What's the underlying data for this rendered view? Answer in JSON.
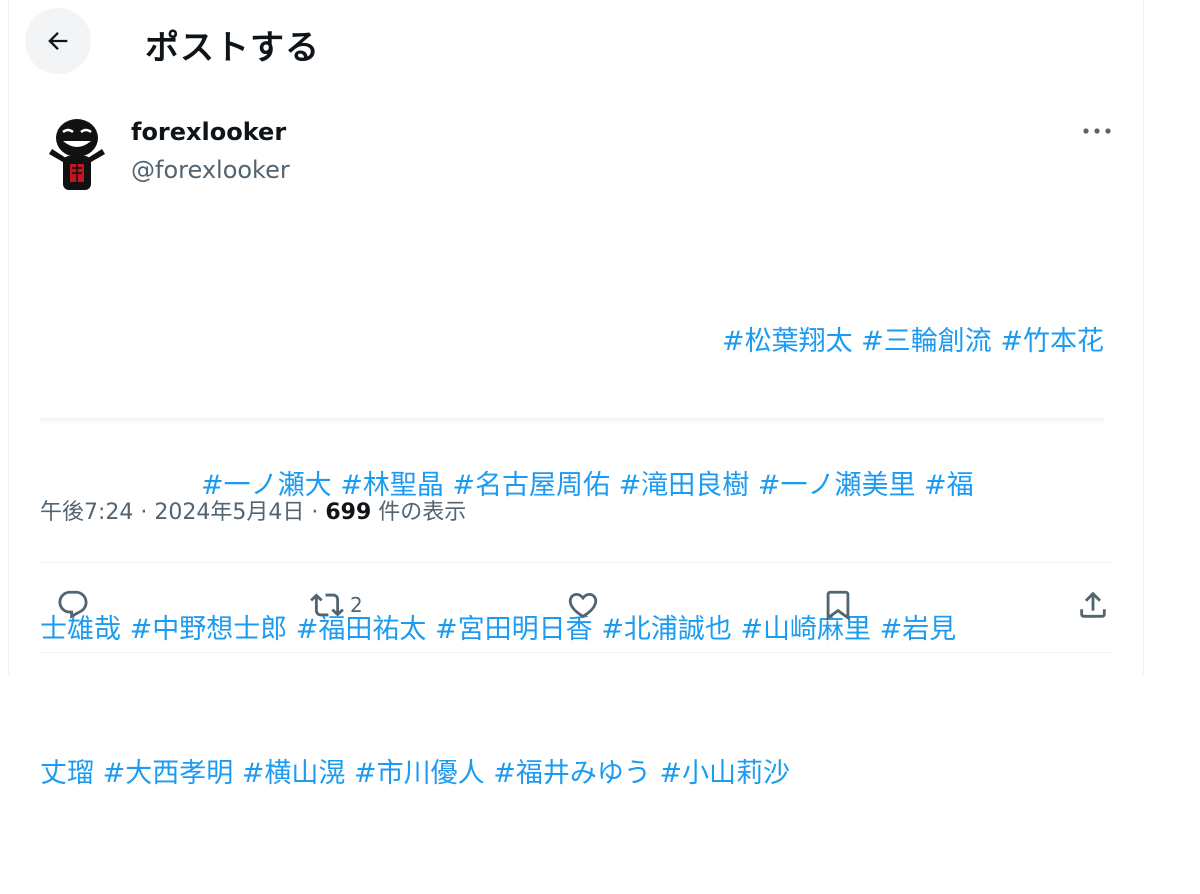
{
  "header": {
    "back_icon": "arrow-left-icon",
    "title": "ポストする"
  },
  "author": {
    "display_name": "forexlooker",
    "handle": "@forexlooker",
    "avatar_icon": "smiling-black-figure-avatar",
    "more_icon": "more-horizontal-icon"
  },
  "tweet": {
    "lines": [
      "#松葉翔太 #三輪創流 #竹本花",
      "#一ノ瀬大 #林聖晶 #名古屋周佑 #滝田良樹 #一ノ瀬美里 #福",
      "士雄哉 #中野想士郎 #福田祐太 #宮田明日香 #北浦誠也 #山崎麻里 #岩見",
      "丈瑠 #大西孝明 #横山滉 #市川優人 #福井みゆう #小山莉沙"
    ]
  },
  "meta": {
    "time": "午後7:24",
    "separator": " · ",
    "date": "2024年5月4日",
    "views_count": "699",
    "views_label": " 件の表示"
  },
  "actions": {
    "reply_icon": "reply-icon",
    "retweet_icon": "retweet-icon",
    "retweet_count": "2",
    "like_icon": "heart-icon",
    "bookmark_icon": "bookmark-icon",
    "share_icon": "share-icon"
  },
  "colors": {
    "link": "#1d9bf0",
    "text": "#0f1419",
    "muted": "#536471",
    "border": "#eff3f4"
  }
}
